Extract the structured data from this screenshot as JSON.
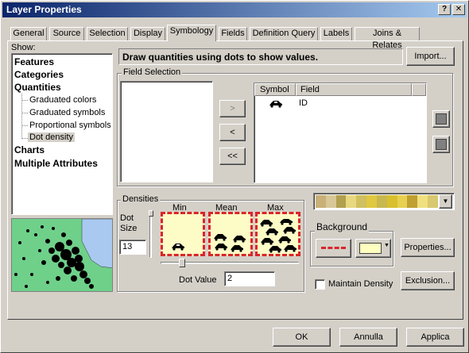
{
  "window": {
    "title": "Layer Properties",
    "help_glyph": "?",
    "close_glyph": "✕"
  },
  "tabs": [
    "General",
    "Source",
    "Selection",
    "Display",
    "Symbology",
    "Fields",
    "Definition Query",
    "Labels",
    "Joins & Relates"
  ],
  "active_tab": "Symbology",
  "show_label": "Show:",
  "tree": {
    "features": "Features",
    "categories": "Categories",
    "quantities": "Quantities",
    "quantities_children": [
      "Graduated colors",
      "Graduated symbols",
      "Proportional symbols",
      "Dot density"
    ],
    "selected_child": "Dot density",
    "charts": "Charts",
    "multiple_attributes": "Multiple Attributes"
  },
  "header": {
    "description": "Draw quantities using dots to show values.",
    "import_label": "Import..."
  },
  "field_selection": {
    "legend": "Field Selection",
    "move_right": ">",
    "move_left": "<",
    "remove_all": "<<",
    "columns": [
      "Symbol",
      "Field"
    ],
    "rows": [
      {
        "symbol": "car-icon",
        "field": "ID"
      }
    ]
  },
  "densities": {
    "legend": "Densities",
    "dot_size_label": "Dot\nSize",
    "dot_size_value": "13",
    "swatch_labels": [
      "Min",
      "Mean",
      "Max"
    ],
    "dot_value_label": "Dot Value",
    "dot_value": "2"
  },
  "color_ramp": {
    "colors": [
      "#c8b078",
      "#d8c898",
      "#b0a050",
      "#e8d880",
      "#d0c060",
      "#e0c840",
      "#c8b850",
      "#d8c030",
      "#e8d050",
      "#c0a030",
      "#f0e080",
      "#d8c870"
    ]
  },
  "background": {
    "legend": "Background",
    "fill_color": "#ffffc0",
    "line_color": "#d8262c"
  },
  "buttons": {
    "properties": "Properties...",
    "exclusion": "Exclusion...",
    "ok": "OK",
    "cancel": "Annulla",
    "apply": "Applica"
  },
  "maintain_density": {
    "label": "Maintain Density",
    "checked": false
  },
  "colors": {
    "accent": "#0a246a",
    "swatch_fill": "#fdfcc6",
    "swatch_border": "#d8262c"
  }
}
